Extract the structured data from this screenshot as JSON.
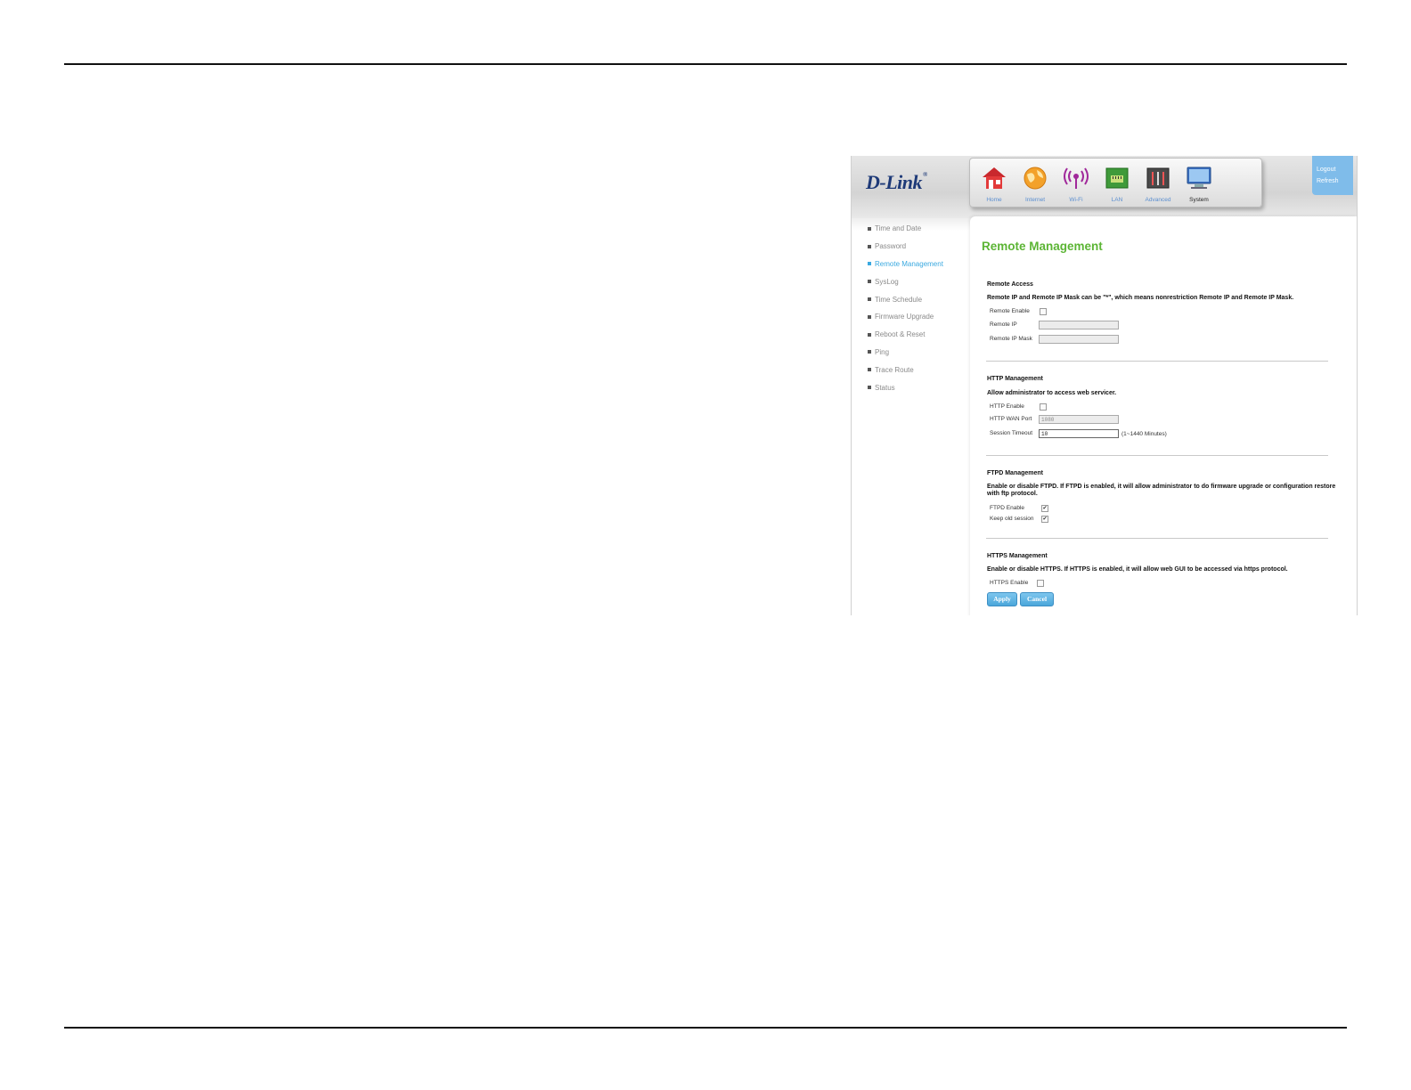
{
  "logo": {
    "brand": "D-Link",
    "registered": "®"
  },
  "nav": [
    {
      "label": "Home",
      "icon": "home-icon"
    },
    {
      "label": "Internet",
      "icon": "globe-icon"
    },
    {
      "label": "Wi-Fi",
      "icon": "wifi-icon"
    },
    {
      "label": "LAN",
      "icon": "lan-port-icon"
    },
    {
      "label": "Advanced",
      "icon": "tools-icon"
    },
    {
      "label": "System",
      "icon": "monitor-icon"
    }
  ],
  "header_links": {
    "logout": "Logout",
    "refresh": "Refresh"
  },
  "sidebar": [
    {
      "label": "Time and Date"
    },
    {
      "label": "Password"
    },
    {
      "label": "Remote Management"
    },
    {
      "label": "SysLog"
    },
    {
      "label": "Time Schedule"
    },
    {
      "label": "Firmware Upgrade"
    },
    {
      "label": "Reboot & Reset"
    },
    {
      "label": "Ping"
    },
    {
      "label": "Trace Route"
    },
    {
      "label": "Status"
    }
  ],
  "page_title": "Remote Management",
  "remote_access": {
    "title": "Remote Access",
    "desc": "Remote IP and Remote IP Mask can be \"*\", which means nonrestriction Remote IP and Remote IP Mask.",
    "enable_label": "Remote Enable",
    "ip_label": "Remote IP",
    "mask_label": "Remote IP Mask",
    "ip_value": "",
    "mask_value": ""
  },
  "http": {
    "title": "HTTP Management",
    "desc": "Allow administrator to access web servicer.",
    "enable_label": "HTTP Enable",
    "port_label": "HTTP WAN Port",
    "port_value": "1080",
    "timeout_label": "Session Timeout",
    "timeout_value": "10",
    "timeout_hint": "(1~1440 Minutes)"
  },
  "ftpd": {
    "title": "FTPD Management",
    "desc": "Enable or disable FTPD. If FTPD is enabled, it will allow administrator to do firmware upgrade or configuration restore with ftp protocol.",
    "enable_label": "FTPD Enable",
    "keep_label": "Keep old session",
    "enable_checked": "✔",
    "keep_checked": "✔"
  },
  "https": {
    "title": "HTTPS Management",
    "desc": "Enable or disable HTTPS. If HTTPS is enabled, it will allow web GUI to be accessed via https protocol.",
    "enable_label": "HTTPS Enable"
  },
  "buttons": {
    "apply": "Apply",
    "cancel": "Cancel"
  }
}
